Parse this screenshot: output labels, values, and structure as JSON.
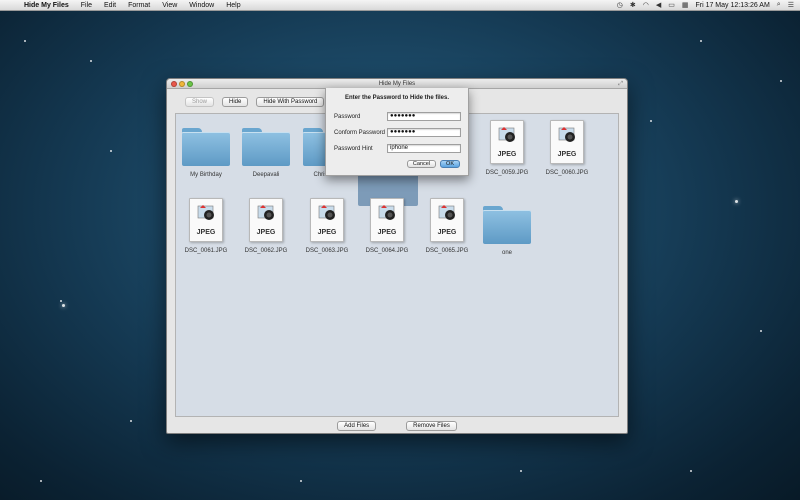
{
  "menubar": {
    "apple_icon": "apple-icon",
    "items": [
      "Hide My Files",
      "File",
      "Edit",
      "Format",
      "View",
      "Window",
      "Help"
    ],
    "clock": "Fri 17 May  12:13:26 AM",
    "status_icons": [
      "time-machine-icon",
      "bluetooth-icon",
      "wifi-icon",
      "volume-icon",
      "battery-icon",
      "flag-icon",
      "user-icon",
      "spotlight-icon",
      "list-icon"
    ]
  },
  "window": {
    "title": "Hide My Files",
    "toolbar": {
      "show_label": "Show",
      "hide_label": "Hide",
      "hide_password_label": "Hide With Password"
    },
    "items": [
      {
        "kind": "folder",
        "label": "My Birthday"
      },
      {
        "kind": "folder",
        "label": "Deepavali"
      },
      {
        "kind": "folder",
        "label": "Christmas"
      },
      {
        "kind": "jpeg",
        "label": "DSC_0059.JPG"
      },
      {
        "kind": "jpeg",
        "label": "DSC_0060.JPG"
      },
      {
        "kind": "jpeg",
        "label": "DSC_0061.JPG"
      },
      {
        "kind": "jpeg",
        "label": "DSC_0062.JPG"
      },
      {
        "kind": "jpeg",
        "label": "DSC_0063.JPG"
      },
      {
        "kind": "jpeg",
        "label": "DSC_0064.JPG"
      },
      {
        "kind": "jpeg",
        "label": "DSC_0065.JPG"
      },
      {
        "kind": "folder",
        "label": "one"
      }
    ],
    "jpeg_badge": "JPEG",
    "bottom": {
      "add_label": "Add Files",
      "remove_label": "Remove Files"
    }
  },
  "dialog": {
    "title": "Enter the Password to Hide the files.",
    "password_label": "Password",
    "password_value": "●●●●●●●",
    "confirm_label": "Conform Password",
    "confirm_value": "●●●●●●●",
    "hint_label": "Password Hint",
    "hint_value": "iphone",
    "cancel_label": "Cancel",
    "ok_label": "OK"
  },
  "colors": {
    "folder_blue": "#6aa6cf",
    "ok_button": "#5ba3e0",
    "content_bg": "#d6dde6"
  }
}
